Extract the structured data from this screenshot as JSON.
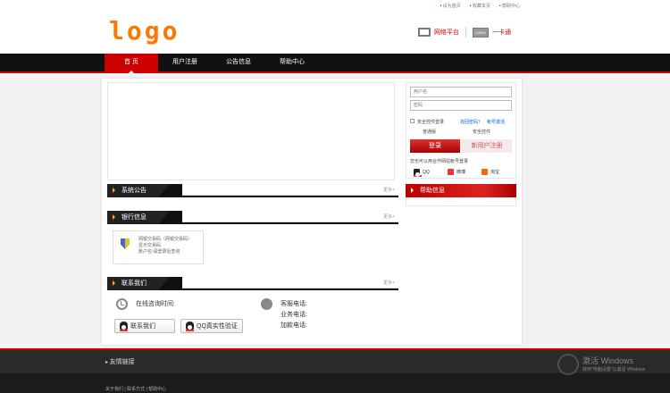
{
  "top_links": [
    "设为首页",
    "收藏本页",
    "帮助中心"
  ],
  "logo_text": "logo",
  "header": {
    "netbank_label": "网络平台",
    "card_label": "一卡通",
    "card_icon_text": "CARD"
  },
  "nav": {
    "items": [
      {
        "label": "首 页",
        "active": true
      },
      {
        "label": "用户注册"
      },
      {
        "label": "公告信息"
      },
      {
        "label": "帮助中心"
      }
    ]
  },
  "panels": {
    "announce": {
      "title": "系统公告",
      "more": "更多+"
    },
    "bank": {
      "title": "银行信息",
      "more": "更多+"
    },
    "contact": {
      "title": "联系我们",
      "more": "更多+"
    }
  },
  "bank_info": {
    "line1": "网银交易码（网银交易码）",
    "line2": "显示交易码",
    "line3": "账户名:请登录后查询"
  },
  "contact": {
    "online_time": "在线咨询时间:",
    "service_phone": "客服电话:",
    "business_phone": "业务电话:",
    "complaint_phone": "加款电话:",
    "contact_btn": "联系我们",
    "qq_verify_btn": "QQ真实性验证"
  },
  "login": {
    "username_placeholder": "用户名",
    "password_placeholder": "密码",
    "safe_login": "安全控件登录",
    "forgot": "找回密码？",
    "activate": "帐号激活",
    "plain_mode": "普通版",
    "safe_ctrl": "安全控件",
    "login_btn": "登录",
    "register_btn": "新用户注册",
    "ext_hint": "您也可以用合作网站帐号登录",
    "ext_qq": "QQ",
    "ext_weibo": "微博",
    "ext_other": "淘宝"
  },
  "help": {
    "title": "帮助信息"
  },
  "footer": {
    "friend_links": "友情链接",
    "bottom_links": "关于我们 | 联系方式 | 帮助中心"
  },
  "watermark": {
    "line1": "激活 Windows",
    "line2": "转到\"电脑设置\"以激活 Windows"
  },
  "colors": {
    "accent": "#cc0000",
    "logo": "#ff7700",
    "nav_bg": "#111111"
  }
}
